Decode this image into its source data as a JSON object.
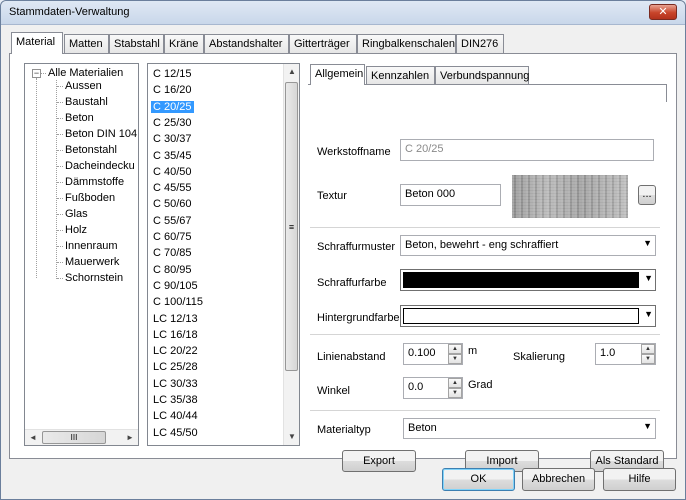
{
  "window": {
    "title": "Stammdaten-Verwaltung",
    "close_label": "✕"
  },
  "outer_tabs": [
    {
      "label": "Material"
    },
    {
      "label": "Matten"
    },
    {
      "label": "Stabstahl"
    },
    {
      "label": "Kräne"
    },
    {
      "label": "Abstandshalter"
    },
    {
      "label": "Gitterträger"
    },
    {
      "label": "Ringbalkenschalen"
    },
    {
      "label": "DIN276"
    }
  ],
  "tree": {
    "root": "Alle Materialien",
    "expander": "−",
    "items": [
      "Aussen",
      "Baustahl",
      "Beton",
      "Beton DIN 104",
      "Betonstahl",
      "Dacheindecku",
      "Dämmstoffe",
      "Fußboden",
      "Glas",
      "Holz",
      "Innenraum",
      "Mauerwerk",
      "Schornstein"
    ],
    "hscroll_left": "◄",
    "hscroll_right": "►",
    "hscroll_thumb": "III"
  },
  "materials": {
    "items": [
      "C 12/15",
      "C 16/20",
      "C 20/25",
      "C 25/30",
      "C 30/37",
      "C 35/45",
      "C 40/50",
      "C 45/55",
      "C 50/60",
      "C 55/67",
      "C 60/75",
      "C 70/85",
      "C 80/95",
      "C 90/105",
      "C 100/115",
      "LC 12/13",
      "LC 16/18",
      "LC 20/22",
      "LC 25/28",
      "LC 30/33",
      "LC 35/38",
      "LC 40/44",
      "LC 45/50"
    ],
    "selected": "C 20/25",
    "scroll_up": "▲",
    "scroll_down": "▼",
    "scroll_grip": "≡"
  },
  "inner_tabs": [
    {
      "label": "Allgemein"
    },
    {
      "label": "Kennzahlen"
    },
    {
      "label": "Verbundspannung"
    }
  ],
  "form": {
    "werkstoffname_label": "Werkstoffname",
    "werkstoffname_value": "C 20/25",
    "textur_label": "Textur",
    "textur_value": "Beton 000",
    "textur_browse": "...",
    "schraffurmuster_label": "Schraffurmuster",
    "schraffurmuster_value": "Beton, bewehrt - eng schraffiert",
    "schraffurfarbe_label": "Schraffurfarbe",
    "schraffurfarbe_color": "#000000",
    "hintergrundfarbe_label": "Hintergrundfarbe",
    "hintergrundfarbe_color": "#ffffff",
    "linienabstand_label": "Linienabstand",
    "linienabstand_value": "0.100",
    "linienabstand_unit": "m",
    "skalierung_label": "Skalierung",
    "skalierung_value": "1.0",
    "winkel_label": "Winkel",
    "winkel_value": "0.0",
    "winkel_unit": "Grad",
    "materialtyp_label": "Materialtyp",
    "materialtyp_value": "Beton",
    "dropdown_arrow": "▼",
    "spin_up": "▲",
    "spin_down": "▼"
  },
  "panel_buttons": {
    "export": "Export",
    "import": "Import",
    "standard": "Als Standard"
  },
  "dialog_buttons": {
    "ok": "OK",
    "cancel": "Abbrechen",
    "help": "Hilfe"
  }
}
